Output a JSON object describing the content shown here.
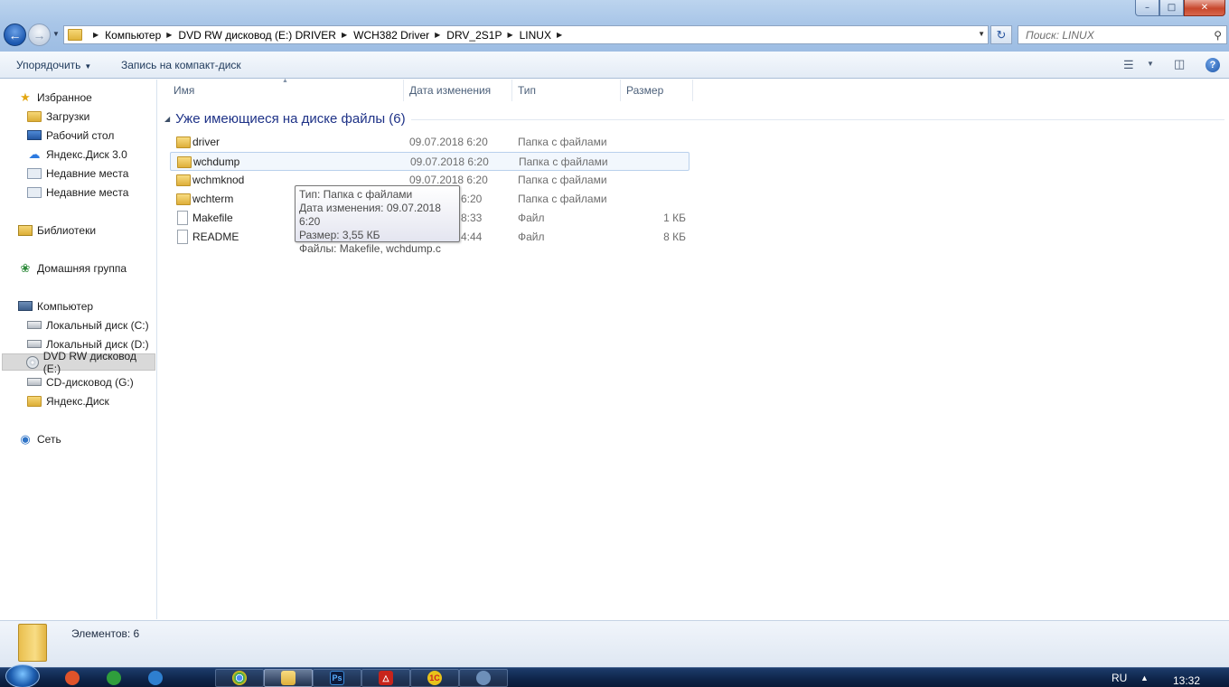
{
  "window": {
    "controls": [
      "minimize",
      "maximize",
      "close"
    ]
  },
  "address": {
    "crumbs": [
      "Компьютер",
      "DVD RW дисковод (E:) DRIVER",
      "WCH382 Driver",
      "DRV_2S1P",
      "LINUX"
    ],
    "search_placeholder": "Поиск: LINUX"
  },
  "toolbar": {
    "organize": "Упорядочить",
    "burn": "Запись на компакт-диск"
  },
  "sidebar": {
    "favorites": {
      "label": "Избранное",
      "items": [
        "Загрузки",
        "Рабочий стол",
        "Яндекс.Диск 3.0",
        "Недавние места",
        "Недавние места"
      ]
    },
    "libraries": "Библиотеки",
    "homegroup": "Домашняя группа",
    "computer": {
      "label": "Компьютер",
      "items": [
        "Локальный диск (C:)",
        "Локальный диск (D:)",
        "DVD RW дисковод (E:)",
        "CD-дисковод (G:)",
        "Яндекс.Диск"
      ],
      "selected": "DVD RW дисковод (E:)"
    },
    "network": "Сеть"
  },
  "columns": {
    "name": "Имя",
    "date": "Дата изменения",
    "type": "Тип",
    "size": "Размер"
  },
  "group": {
    "title": "Уже имеющиеся на диске файлы (6)"
  },
  "files": [
    {
      "name": "driver",
      "date": "09.07.2018 6:20",
      "type": "Папка с файлами",
      "size": "",
      "icon": "folder"
    },
    {
      "name": "wchdump",
      "date": "09.07.2018 6:20",
      "type": "Папка с файлами",
      "size": "",
      "icon": "folder"
    },
    {
      "name": "wchmknod",
      "date": "09.07.2018 6:20",
      "type": "Папка с файлами",
      "size": "",
      "icon": "folder"
    },
    {
      "name": "wchterm",
      "date": "6:20",
      "type": "Папка с файлами",
      "size": "",
      "icon": "folder"
    },
    {
      "name": "Makefile",
      "date": "8:33",
      "type": "Файл",
      "size": "1 КБ",
      "icon": "file"
    },
    {
      "name": "README",
      "date": "4:44",
      "type": "Файл",
      "size": "8 КБ",
      "icon": "file"
    }
  ],
  "hovered_row": "wchdump",
  "tooltip": {
    "line1": "Тип: Папка с файлами",
    "line2": "Дата изменения: 09.07.2018 6:20",
    "line3": "Размер: 3,55 КБ",
    "line4": "Файлы: Makefile, wchdump.c"
  },
  "details": {
    "count": "Элементов: 6"
  },
  "taskbar": {
    "apps": [
      {
        "icon": "chrome-icon",
        "color": "#1aa260"
      },
      {
        "icon": "explorer-icon",
        "color": "#e0b43c"
      },
      {
        "icon": "photoshop-icon",
        "label": "Ps",
        "color": "#0b1a3c"
      },
      {
        "icon": "acrobat-icon",
        "color": "#c8241b"
      },
      {
        "icon": "1c-icon",
        "label": "1С",
        "color": "#e8c21a"
      },
      {
        "icon": "paint-icon",
        "color": "#6d8fb9"
      }
    ],
    "lang": "RU",
    "clock": "13:32"
  },
  "colors": {
    "accent": "#1e3287",
    "hover_border": "#b9d0ec",
    "taskbar": "#0e2449"
  }
}
